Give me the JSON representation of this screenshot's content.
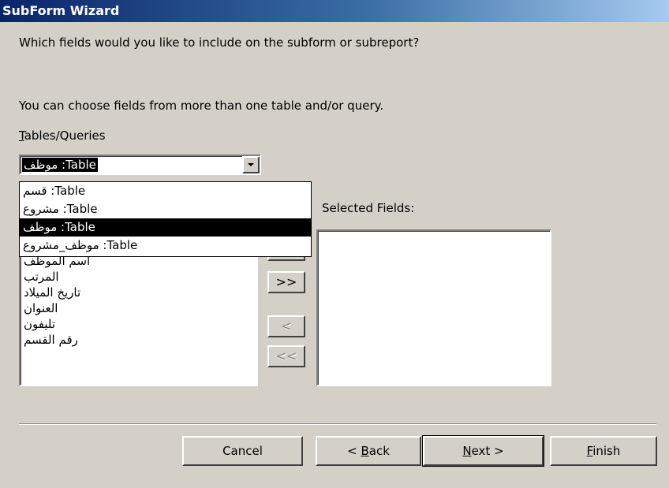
{
  "window": {
    "title": "SubForm Wizard"
  },
  "instructions": {
    "question": "Which fields would you like to include on the subform or subreport?",
    "note": "You can choose fields from more than one table and/or query."
  },
  "tables_queries": {
    "label_accel": "T",
    "label_rest": "ables/Queries",
    "selected": "Table: موظف",
    "options": [
      "Table: قسم",
      "Table: مشروع",
      "Table: موظف",
      "Table: موظف_مشروع"
    ],
    "selected_index": 2
  },
  "available_fields": {
    "items": [
      "اسم الموظف",
      "المرتب",
      "تاريخ الميلاد",
      "العنوان",
      "تليفون",
      "رقم القسم"
    ]
  },
  "selected_fields": {
    "label": "Selected Fields:",
    "items": []
  },
  "move_buttons": {
    "add_one": ">",
    "add_all": ">>",
    "remove_one": "<",
    "remove_all": "<<"
  },
  "buttons": {
    "cancel": "Cancel",
    "back_prefix": "< ",
    "back_accel": "B",
    "back_rest": "ack",
    "next_accel": "N",
    "next_rest": "ext >",
    "finish_accel": "F",
    "finish_rest": "inish"
  }
}
